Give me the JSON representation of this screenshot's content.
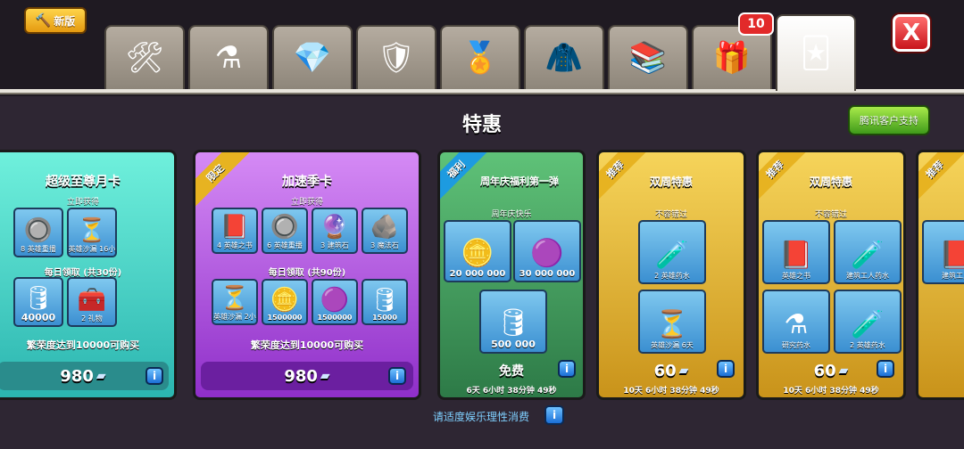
{
  "header": {
    "new_button": {
      "label": "新版",
      "icon": "hammer-icon"
    },
    "tabs": [
      {
        "icon": "builder-tools-icon",
        "glyph": "🛠"
      },
      {
        "icon": "magic-item-icon",
        "glyph": "⚗"
      },
      {
        "icon": "gems-coins-icon",
        "glyph": "💎"
      },
      {
        "icon": "clan-shield-icon",
        "glyph": "🛡"
      },
      {
        "icon": "league-badge-icon",
        "glyph": "🏅"
      },
      {
        "icon": "hanger-icon",
        "glyph": "🧥"
      },
      {
        "icon": "book-potion-icon",
        "glyph": "📚"
      },
      {
        "icon": "gift-box-icon",
        "glyph": "🎁"
      },
      {
        "icon": "special-offers-icon",
        "glyph": "🃏"
      }
    ],
    "gift_badge": "10",
    "close_label": "X"
  },
  "page": {
    "title": "特惠",
    "support_button": "腾讯客户支持",
    "footer_note": "请适度娱乐理性消费",
    "info_label": "i"
  },
  "cards": {
    "monthly": {
      "title": "超级至尊月卡",
      "immediate_label": "立即获得",
      "daily_label": "每日领取 (共30份)",
      "requirement": "繁荣度达到10000可购买",
      "price": "980",
      "items": [
        {
          "label": "8 英雄重播",
          "icon": "orb-icon",
          "glyph": "🔘"
        },
        {
          "label": "英雄沙漏 16小",
          "icon": "hourglass-icon",
          "glyph": "⏳"
        },
        {
          "label": "40000",
          "icon": "dark-elixir-icon",
          "glyph": "🛢"
        },
        {
          "label": "2 礼物",
          "icon": "chest-icon",
          "glyph": "🧰"
        }
      ]
    },
    "season": {
      "ribbon": "限定",
      "title": "加速季卡",
      "immediate_label": "立即获得",
      "daily_label": "每日领取 (共90份)",
      "requirement": "繁荣度达到10000可购买",
      "price": "980",
      "items": [
        {
          "label": "4 英雄之书",
          "icon": "book-icon",
          "glyph": "📕"
        },
        {
          "label": "6 英雄重播",
          "icon": "orb-icon",
          "glyph": "🔘"
        },
        {
          "label": "3 建筑石",
          "icon": "stone-icon",
          "glyph": "🔮"
        },
        {
          "label": "3 魔法石",
          "icon": "rune-icon",
          "glyph": "🪨"
        },
        {
          "label": "英雄沙漏 2小",
          "icon": "hourglass-icon",
          "glyph": "⏳"
        },
        {
          "label": "1500000",
          "icon": "gold-icon",
          "glyph": "🪙"
        },
        {
          "label": "1500000",
          "icon": "elixir-icon",
          "glyph": "🟣"
        },
        {
          "label": "15000",
          "icon": "dark-elixir-icon",
          "glyph": "🛢"
        }
      ]
    },
    "anniversary": {
      "ribbon": "福利",
      "title": "周年庆福利第一弹",
      "subtitle": "周年庆快乐",
      "price": "免费",
      "timer": "6天 6小时 38分钟 49秒",
      "items": [
        {
          "label": "20 000 000",
          "icon": "gold-icon",
          "glyph": "🪙"
        },
        {
          "label": "30 000 000",
          "icon": "elixir-icon",
          "glyph": "🟣"
        },
        {
          "label": "500 000",
          "icon": "dark-elixir-icon",
          "glyph": "🛢"
        }
      ]
    },
    "biweekly_1": {
      "ribbon": "推荐",
      "title": "双周特惠",
      "subtitle": "不容错过",
      "price": "60",
      "timer": "10天 6小时 38分钟 49秒",
      "items": [
        {
          "label": "2 英雄药水",
          "icon": "potion-icon",
          "glyph": "🧪"
        },
        {
          "label": "英雄沙漏 6天",
          "icon": "hourglass-icon",
          "glyph": "⏳"
        }
      ]
    },
    "biweekly_2": {
      "ribbon": "推荐",
      "title": "双周特惠",
      "subtitle": "不容错过",
      "price": "60",
      "timer": "10天 6小时 38分钟 49秒",
      "items": [
        {
          "label": "英雄之书",
          "icon": "book-icon",
          "glyph": "📕"
        },
        {
          "label": "建筑工人药水",
          "icon": "potion-icon",
          "glyph": "🧪"
        },
        {
          "label": "研究药水",
          "icon": "research-potion-icon",
          "glyph": "⚗"
        },
        {
          "label": "2 英雄药水",
          "icon": "potion-icon",
          "glyph": "🧪"
        }
      ]
    },
    "partial": {
      "ribbon": "推荐",
      "items": [
        {
          "label": "建筑工人",
          "icon": "book-icon",
          "glyph": "📕"
        }
      ]
    }
  },
  "colors": {
    "monthly": "#4fd6c8",
    "season": "#b04fe0",
    "anniversary": "#3f9a5c",
    "biweekly": "#e6b52a"
  }
}
